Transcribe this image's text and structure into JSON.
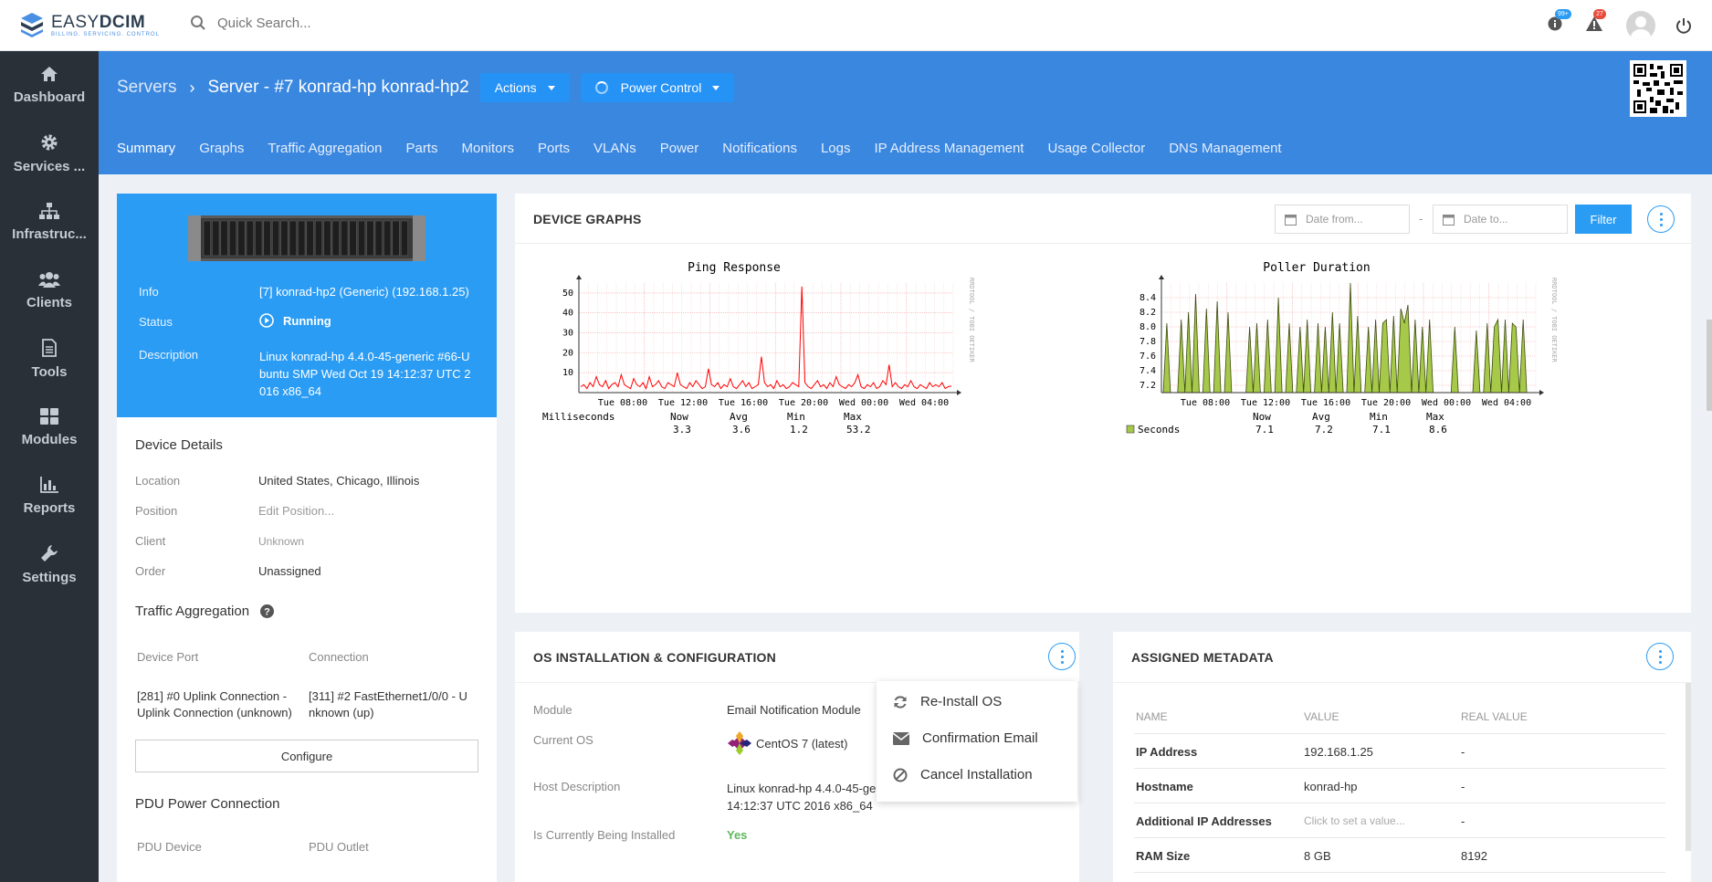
{
  "topbar": {
    "logo_name_a": "EASY",
    "logo_name_b": "DCIM",
    "logo_tag": "BILLING. SERVICING. CONTROL",
    "search_placeholder": "Quick Search...",
    "info_badge": "99+",
    "alert_badge": "27",
    "colors": {
      "info_badge": "#2b9cf4",
      "alert_badge": "#e74c3c"
    }
  },
  "sidebar": {
    "items": [
      {
        "label": "Dashboard",
        "icon": "home-icon"
      },
      {
        "label": "Services ...",
        "icon": "gear-icon"
      },
      {
        "label": "Infrastruc...",
        "icon": "sitemap-icon"
      },
      {
        "label": "Clients",
        "icon": "users-icon"
      },
      {
        "label": "Tools",
        "icon": "document-icon"
      },
      {
        "label": "Modules",
        "icon": "grid-icon"
      },
      {
        "label": "Reports",
        "icon": "bar-chart-icon"
      },
      {
        "label": "Settings",
        "icon": "wrench-icon"
      }
    ]
  },
  "header": {
    "breadcrumb_root": "Servers",
    "breadcrumb_current": "Server - #7 konrad-hp konrad-hp2",
    "actions_label": "Actions",
    "power_label": "Power Control",
    "tabs": [
      "Summary",
      "Graphs",
      "Traffic Aggregation",
      "Parts",
      "Monitors",
      "Ports",
      "VLANs",
      "Power",
      "Notifications",
      "Logs",
      "IP Address Management",
      "Usage Collector",
      "DNS Management"
    ],
    "active_tab": "Summary"
  },
  "device": {
    "info_label": "Info",
    "info_value": "[7] konrad-hp2 (Generic) (192.168.1.25)",
    "status_label": "Status",
    "status_value": "Running",
    "description_label": "Description",
    "description_value_1": "Linux konrad-hp 4.4.0-45-generic #66-U",
    "description_value_2": "buntu SMP Wed Oct 19 14:12:37 UTC 2",
    "description_value_3": "016 x86_64"
  },
  "details": {
    "title": "Device Details",
    "location_label": "Location",
    "location_value": "United States, Chicago, Illinois",
    "position_label": "Position",
    "position_value": "Edit Position...",
    "client_label": "Client",
    "client_value": "Unknown",
    "order_label": "Order",
    "order_value": "Unassigned",
    "traffic_title": "Traffic Aggregation",
    "col_port": "Device Port",
    "col_connection": "Connection",
    "port_value_1": "[281] #0 Uplink Connection -",
    "port_value_2": "Uplink Connection (unknown)",
    "conn_value_1": "[311] #2 FastEthernet1/0/0 - U",
    "conn_value_2": "nknown (up)",
    "configure_label": "Configure",
    "pdu_title": "PDU Power Connection",
    "pdu_device": "PDU Device",
    "pdu_outlet": "PDU Outlet"
  },
  "graphs": {
    "title": "DEVICE GRAPHS",
    "date_from": "Date from...",
    "date_sep": "-",
    "date_to": "Date to...",
    "filter_label": "Filter",
    "watermark": "RRDTOOL / TOBI OETIKER"
  },
  "chart_data": [
    {
      "type": "line",
      "title": "Ping Response",
      "ylabel": "Milliseconds",
      "color": "#ff0000",
      "yticks": [
        "50",
        "40",
        "30",
        "20",
        "10"
      ],
      "ylim": [
        0,
        55
      ],
      "xticks": [
        "Tue 08:00",
        "Tue 12:00",
        "Tue 16:00",
        "Tue 20:00",
        "Wed 00:00",
        "Wed 04:00"
      ],
      "stats_headers": [
        "Now",
        "Avg",
        "Min",
        "Max"
      ],
      "stats_values": [
        "3.3",
        "3.6",
        "1.2",
        "53.2"
      ],
      "series": [
        {
          "name": "Milliseconds",
          "values": [
            3,
            4,
            2,
            5,
            3,
            8,
            4,
            3,
            6,
            2,
            4,
            5,
            3,
            9,
            4,
            3,
            2,
            7,
            4,
            3,
            5,
            2,
            8,
            3,
            4,
            6,
            3,
            2,
            5,
            4,
            3,
            10,
            4,
            3,
            2,
            5,
            3,
            6,
            4,
            2,
            3,
            12,
            4,
            3,
            5,
            2,
            4,
            3,
            7,
            3,
            2,
            4,
            6,
            3,
            5,
            2,
            3,
            4,
            18,
            5,
            3,
            4,
            2,
            6,
            3,
            4,
            2,
            3,
            5,
            4,
            3,
            53.2,
            5,
            3,
            2,
            4,
            6,
            3,
            4,
            2,
            5,
            3,
            8,
            4,
            3,
            2,
            4,
            3,
            5,
            9,
            3,
            2,
            4,
            3,
            5,
            2,
            3,
            6,
            4,
            14,
            3,
            5,
            3,
            2,
            4,
            3,
            6,
            3,
            2,
            4,
            3,
            2,
            5,
            3,
            4,
            3,
            5,
            2,
            3,
            3.3
          ]
        }
      ]
    },
    {
      "type": "area",
      "title": "Poller Duration",
      "color": "#a6c94a",
      "yticks": [
        "8.4",
        "8.2",
        "8.0",
        "7.8",
        "7.6",
        "7.4",
        "7.2"
      ],
      "ylim": [
        7.1,
        8.6
      ],
      "xticks": [
        "Tue 08:00",
        "Tue 12:00",
        "Tue 16:00",
        "Tue 20:00",
        "Wed 00:00",
        "Wed 04:00"
      ],
      "stats_headers": [
        "Now",
        "Avg",
        "Min",
        "Max"
      ],
      "legend": "Seconds",
      "stats_values": [
        "7.1",
        "7.2",
        "7.1",
        "8.6"
      ],
      "series": [
        {
          "name": "Seconds",
          "values": [
            7.1,
            8.05,
            7.1,
            7.1,
            7.1,
            8.1,
            7.1,
            8.2,
            7.1,
            8.45,
            7.1,
            7.1,
            8.25,
            7.1,
            7.1,
            8.35,
            7.1,
            7.1,
            8.2,
            7.1,
            7.1,
            7.1,
            7.1,
            7.1,
            8.0,
            7.1,
            8.05,
            7.1,
            7.1,
            8.1,
            7.1,
            7.1,
            8.4,
            7.1,
            7.1,
            8.05,
            7.1,
            7.1,
            8.0,
            7.1,
            8.1,
            7.1,
            7.1,
            8.05,
            7.1,
            8.0,
            7.1,
            8.2,
            7.1,
            8.05,
            7.1,
            7.1,
            8.6,
            7.1,
            8.15,
            7.1,
            7.1,
            8.0,
            7.1,
            8.1,
            7.1,
            8.05,
            8.1,
            7.1,
            8.15,
            7.1,
            8.25,
            8.05,
            8.3,
            7.1,
            8.1,
            7.1,
            8.0,
            7.1,
            8.1,
            7.1,
            7.1,
            7.1,
            7.1,
            7.1,
            7.1,
            8.0,
            7.1,
            7.1,
            7.1,
            7.1,
            7.1,
            7.95,
            7.1,
            7.1,
            8.05,
            7.1,
            8.0,
            8.1,
            7.1,
            8.1,
            7.1,
            8.05,
            8.0,
            7.1,
            8.1,
            7.1,
            7.1,
            7.1
          ]
        }
      ]
    }
  ],
  "os": {
    "title": "OS INSTALLATION & CONFIGURATION",
    "module_label": "Module",
    "module_value": "Email Notification Module",
    "current_os_label": "Current OS",
    "current_os_value": "CentOS 7 (latest)",
    "host_desc_label": "Host Description",
    "host_desc_value_1": "Linux konrad-hp 4.4.0-45-ge",
    "host_desc_value_2": "14:12:37 UTC 2016 x86_64",
    "installing_label": "Is Currently Being Installed",
    "installing_value": "Yes",
    "menu": [
      {
        "label": "Re-Install OS",
        "icon": "refresh-icon"
      },
      {
        "label": "Confirmation Email",
        "icon": "envelope-icon"
      },
      {
        "label": "Cancel Installation",
        "icon": "ban-icon"
      }
    ]
  },
  "metadata": {
    "title": "ASSIGNED METADATA",
    "headers": [
      "NAME",
      "VALUE",
      "REAL VALUE"
    ],
    "rows": [
      {
        "name": "IP Address",
        "value": "192.168.1.25",
        "real": "-"
      },
      {
        "name": "Hostname",
        "value": "konrad-hp",
        "real": "-"
      },
      {
        "name": "Additional IP Addresses",
        "value": "Click to set a value...",
        "real": "-"
      },
      {
        "name": "RAM Size",
        "value": "8 GB",
        "real": "8192"
      }
    ]
  }
}
